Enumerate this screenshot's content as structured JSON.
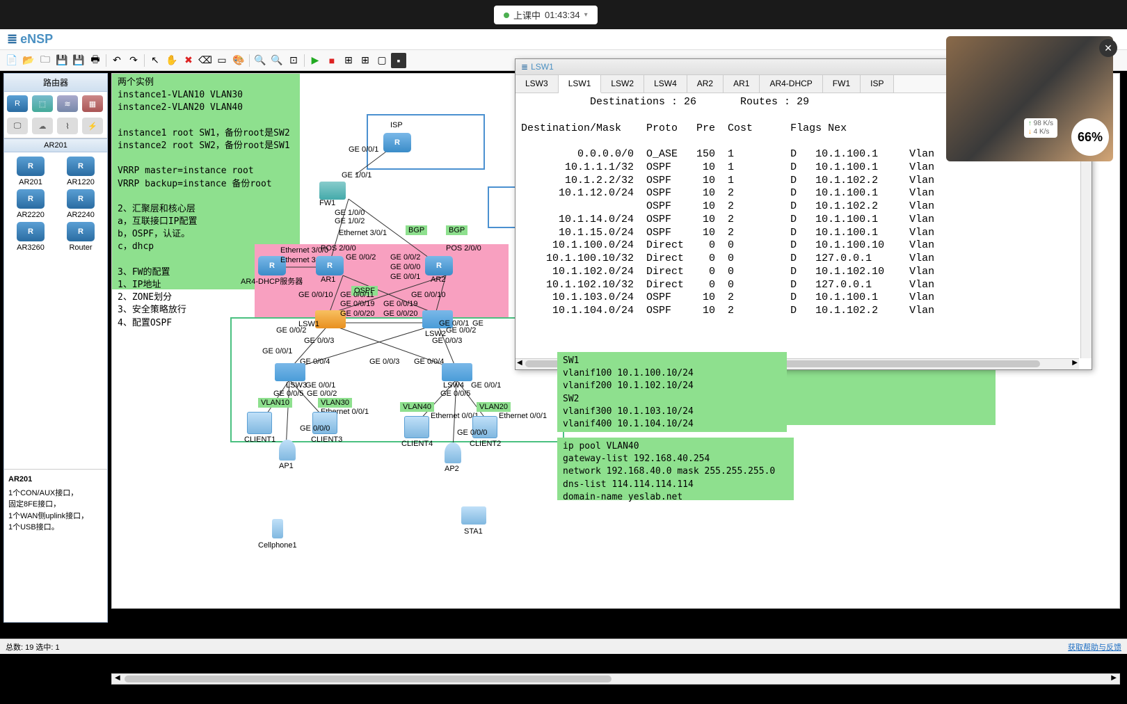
{
  "session": {
    "status": "上课中",
    "time": "01:43:34",
    "upload": "98 K/s",
    "download": "4 K/s",
    "percent": "66%"
  },
  "app": {
    "name": "eNSP",
    "sidebar_title": "路由器",
    "device_section": "AR201",
    "devices": [
      "AR201",
      "AR1220",
      "AR2220",
      "AR2240",
      "AR3260",
      "Router"
    ],
    "info": {
      "title": "AR201",
      "lines": [
        "1个CON/AUX接口，",
        "固定8FE接口，",
        "1个WAN侧uplink接口，",
        "1个USB接口。"
      ]
    }
  },
  "notes": {
    "config1": "两个实例\ninstance1-VLAN10 VLAN30\ninstance2-VLAN20 VLAN40\n\ninstance1 root SW1，备份root是SW2\ninstance2 root SW2，备份root是SW1\n\nVRRP master=instance root\nVRRP backup=instance 备份root\n\n2、汇聚层和核心层\na，互联接口IP配置\nb，OSPF，认证。\nc，dhcp\n\n3、FW的配置\n1、IP地址\n2、ZONE划分\n3、安全策略放行\n4、配置OSPF",
    "sw_vlan": "SW1\nvlanif100 10.1.100.10/24\nvlanif200 10.1.102.10/24\nSW2\nvlanif300 10.1.103.10/24\nvlanif400 10.1.104.10/24",
    "ippool": "ip pool VLAN40\ngateway-list 192.168.40.254\nnetwork 192.168.40.0 mask 255.255.255.0\ndns-list 114.114.114.114\ndomain-name yeslab.net"
  },
  "topology": {
    "isp": "ISP",
    "fw1": "FW1",
    "ar1": "AR1",
    "ar2": "AR2",
    "ar4": "AR4-DHCP服务器",
    "lsw1": "LSW1",
    "lsw2": "LSW2",
    "lsw3": "LSW3",
    "lsw4": "LSW4",
    "client1": "CLIENT1",
    "client2": "CLIENT2",
    "client3": "CLIENT3",
    "client4": "CLIENT4",
    "ap1": "AP1",
    "ap2": "AP2",
    "cellphone": "Cellphone1",
    "sta1": "STA1",
    "proto_bgp": "BGP",
    "proto_ospf": "OSPF",
    "vlan10": "VLAN10",
    "vlan20": "VLAN20",
    "vlan30": "VLAN30",
    "vlan40": "VLAN40",
    "ports": {
      "ge0001": "GE 0/0/1",
      "ge0002": "GE 0/0/2",
      "ge0003": "GE 0/0/3",
      "ge0004": "GE 0/0/4",
      "ge0005": "GE 0/0/5",
      "ge0010": "GE 0/0/10",
      "ge0011": "GE 0/0/11",
      "ge0019": "GE 0/0/19",
      "ge0020": "GE 0/0/20",
      "ge000": "GE 0/0/0",
      "ge100": "GE 1/0/0",
      "ge101": "GE 1/0/1",
      "ge102": "GE 1/0/2",
      "eth301": "Ethernet 3/0/1",
      "eth300": "Ethernet 3/0/0",
      "eth001": "Ethernet 0/0/1",
      "pos200": "POS 2/0/0"
    }
  },
  "terminal": {
    "title": "LSW1",
    "tabs": [
      "LSW3",
      "LSW1",
      "LSW2",
      "LSW4",
      "AR2",
      "AR1",
      "AR4-DHCP",
      "FW1",
      "ISP"
    ],
    "active_tab": 1,
    "summary": "           Destinations : 26       Routes : 29",
    "header": "Destination/Mask    Proto   Pre  Cost      Flags Nex",
    "rows": [
      {
        "dest": "0.0.0.0/0",
        "proto": "O_ASE",
        "pre": "150",
        "cost": "1",
        "flags": "D",
        "next": "10.1.100.1",
        "if": "Vlan"
      },
      {
        "dest": "10.1.1.1/32",
        "proto": "OSPF",
        "pre": "10",
        "cost": "1",
        "flags": "D",
        "next": "10.1.100.1",
        "if": "Vlan"
      },
      {
        "dest": "10.1.2.2/32",
        "proto": "OSPF",
        "pre": "10",
        "cost": "1",
        "flags": "D",
        "next": "10.1.102.2",
        "if": "Vlan"
      },
      {
        "dest": "10.1.12.0/24",
        "proto": "OSPF",
        "pre": "10",
        "cost": "2",
        "flags": "D",
        "next": "10.1.100.1",
        "if": "Vlan"
      },
      {
        "dest": "",
        "proto": "OSPF",
        "pre": "10",
        "cost": "2",
        "flags": "D",
        "next": "10.1.102.2",
        "if": "Vlan"
      },
      {
        "dest": "10.1.14.0/24",
        "proto": "OSPF",
        "pre": "10",
        "cost": "2",
        "flags": "D",
        "next": "10.1.100.1",
        "if": "Vlan"
      },
      {
        "dest": "10.1.15.0/24",
        "proto": "OSPF",
        "pre": "10",
        "cost": "2",
        "flags": "D",
        "next": "10.1.100.1",
        "if": "Vlan"
      },
      {
        "dest": "10.1.100.0/24",
        "proto": "Direct",
        "pre": "0",
        "cost": "0",
        "flags": "D",
        "next": "10.1.100.10",
        "if": "Vlan"
      },
      {
        "dest": "10.1.100.10/32",
        "proto": "Direct",
        "pre": "0",
        "cost": "0",
        "flags": "D",
        "next": "127.0.0.1",
        "if": "Vlan"
      },
      {
        "dest": "10.1.102.0/24",
        "proto": "Direct",
        "pre": "0",
        "cost": "0",
        "flags": "D",
        "next": "10.1.102.10",
        "if": "Vlan"
      },
      {
        "dest": "10.1.102.10/32",
        "proto": "Direct",
        "pre": "0",
        "cost": "0",
        "flags": "D",
        "next": "127.0.0.1",
        "if": "Vlan"
      },
      {
        "dest": "10.1.103.0/24",
        "proto": "OSPF",
        "pre": "10",
        "cost": "2",
        "flags": "D",
        "next": "10.1.100.1",
        "if": "Vlan"
      },
      {
        "dest": "10.1.104.0/24",
        "proto": "OSPF",
        "pre": "10",
        "cost": "2",
        "flags": "D",
        "next": "10.1.102.2",
        "if": "Vlan"
      }
    ]
  },
  "statusbar": {
    "left": "总数: 19  选中: 1",
    "right": "获取帮助与反馈"
  }
}
